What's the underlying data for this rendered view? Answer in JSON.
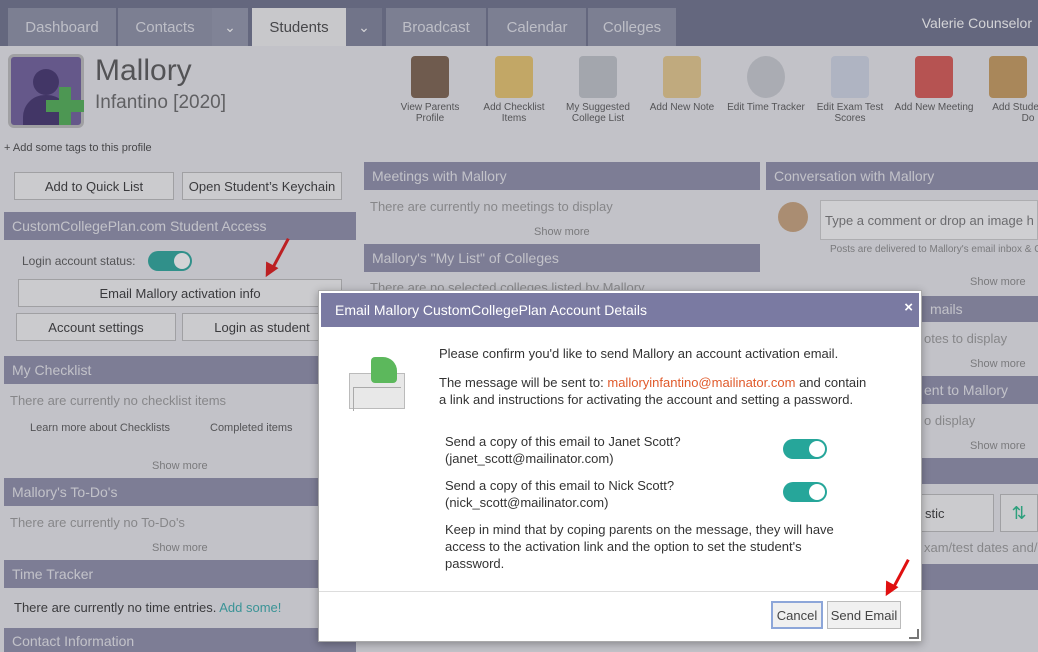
{
  "nav": {
    "tabs": [
      "Dashboard",
      "Contacts",
      "Students",
      "Broadcast",
      "Calendar",
      "Colleges"
    ],
    "user": "Valerie Counselor"
  },
  "profile": {
    "first_name": "Mallory",
    "last_name_year": "Infantino [2020]",
    "tags_link": "+ Add some tags to this profile"
  },
  "actions": [
    {
      "label": "View Parents Profile",
      "icon": "parents-icon",
      "color": "#7a5f4a"
    },
    {
      "label": "Add Checklist Items",
      "icon": "notepad-icon",
      "color": "#e8c46a"
    },
    {
      "label": "My Suggested College List",
      "icon": "building-icon",
      "color": "#bfc3c8"
    },
    {
      "label": "Add New Note",
      "icon": "note-icon",
      "color": "#e6c98a"
    },
    {
      "label": "Edit Time Tracker",
      "icon": "stopwatch-icon",
      "color": "#c8cbd0"
    },
    {
      "label": "Edit Exam Test Scores",
      "icon": "pencil-paper-icon",
      "color": "#cfd6e4"
    },
    {
      "label": "Add New Meeting",
      "icon": "calendar-icon",
      "color": "#d9544f"
    },
    {
      "label": "Add Student To-Do",
      "icon": "clipboard-icon",
      "color": "#c79a5a"
    }
  ],
  "left": {
    "quick_list": "Add to Quick List",
    "keychain": "Open Student’s Keychain",
    "access_header": "CustomCollegePlan.com Student Access",
    "login_status": "Login account status:",
    "email_activation": "Email Mallory activation info",
    "account_settings": "Account settings",
    "login_as": "Login as student",
    "checklist_header": "My Checklist",
    "checklist_empty": "There are currently no checklist items",
    "learn_more": "Learn more about Checklists",
    "completed": "Completed items",
    "show_more": "Show more",
    "todo_header": "Mallory's To-Do's",
    "todo_empty": "There are currently no To-Do's",
    "time_header": "Time Tracker",
    "time_empty": "There are currently no time entries.",
    "time_add": "Add some!",
    "contact_header": "Contact Information"
  },
  "middle": {
    "meetings_header": "Meetings with Mallory",
    "meetings_empty": "There are currently no meetings to display",
    "show_more": "Show more",
    "mylist_header": "Mallory's \"My List\" of Colleges",
    "mylist_empty": "There are no selected colleges listed by Mallory"
  },
  "right": {
    "conversation_header": "Conversation with Mallory",
    "comment_placeholder": "Type a comment or drop an image here",
    "posts_note": "Posts are delivered to Mallory's email inbox & C",
    "show_more": "Show more",
    "emails_frag": "mails",
    "notes_frag": "otes to display",
    "sent_frag": "ent to Mallory",
    "display_frag": "o display",
    "stic_frag": "stic",
    "exam_frag": "xam/test dates and/"
  },
  "modal": {
    "title": "Email Mallory CustomCollegePlan Account Details",
    "close": "×",
    "confirm": "Please confirm you'd like to send Mallory an account activation email.",
    "sent_to_pre": "The message will be sent to:",
    "email": "malloryinfantino@mailinator.com",
    "sent_to_post": "and contain",
    "sent_to_line2": "a link and instructions for activating the account and setting a password.",
    "copy1_line1": "Send a copy of this email to Janet Scott?",
    "copy1_line2": "(janet_scott@mailinator.com)",
    "copy2_line1": "Send a copy of this email to Nick Scott?",
    "copy2_line2": "(nick_scott@mailinator.com)",
    "keep_line1": "Keep in mind that by coping parents on the message, they will have",
    "keep_line2": "access to the activation link and the option to set the student's",
    "keep_line3": "password.",
    "cancel": "Cancel",
    "send": "Send Email"
  }
}
